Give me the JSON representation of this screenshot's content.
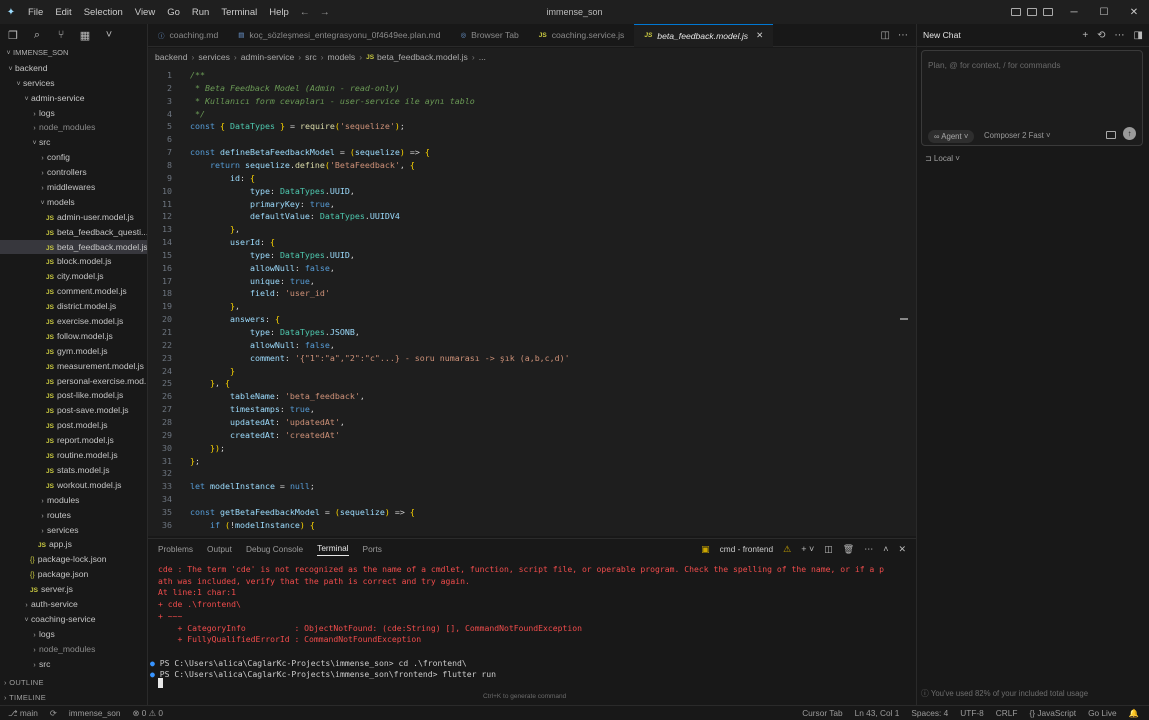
{
  "window": {
    "title": "immense_son",
    "menu": [
      "File",
      "Edit",
      "Selection",
      "View",
      "Go",
      "Run",
      "Terminal",
      "Help"
    ]
  },
  "explorer": {
    "root": "IMMENSE_SON",
    "items": [
      {
        "label": "backend",
        "depth": 0,
        "type": "folder-open"
      },
      {
        "label": "services",
        "depth": 1,
        "type": "folder-open"
      },
      {
        "label": "admin-service",
        "depth": 2,
        "type": "folder-open"
      },
      {
        "label": "logs",
        "depth": 3,
        "type": "folder"
      },
      {
        "label": "node_modules",
        "depth": 3,
        "type": "folder",
        "dim": true
      },
      {
        "label": "src",
        "depth": 3,
        "type": "folder-open"
      },
      {
        "label": "config",
        "depth": 4,
        "type": "folder"
      },
      {
        "label": "controllers",
        "depth": 4,
        "type": "folder"
      },
      {
        "label": "middlewares",
        "depth": 4,
        "type": "folder"
      },
      {
        "label": "models",
        "depth": 4,
        "type": "folder-open"
      },
      {
        "label": "admin-user.model.js",
        "depth": 5,
        "type": "js"
      },
      {
        "label": "beta_feedback_questi...",
        "depth": 5,
        "type": "js"
      },
      {
        "label": "beta_feedback.model.js",
        "depth": 5,
        "type": "js",
        "selected": true
      },
      {
        "label": "block.model.js",
        "depth": 5,
        "type": "js"
      },
      {
        "label": "city.model.js",
        "depth": 5,
        "type": "js"
      },
      {
        "label": "comment.model.js",
        "depth": 5,
        "type": "js"
      },
      {
        "label": "district.model.js",
        "depth": 5,
        "type": "js"
      },
      {
        "label": "exercise.model.js",
        "depth": 5,
        "type": "js"
      },
      {
        "label": "follow.model.js",
        "depth": 5,
        "type": "js"
      },
      {
        "label": "gym.model.js",
        "depth": 5,
        "type": "js"
      },
      {
        "label": "measurement.model.js",
        "depth": 5,
        "type": "js"
      },
      {
        "label": "personal-exercise.mod...",
        "depth": 5,
        "type": "js"
      },
      {
        "label": "post-like.model.js",
        "depth": 5,
        "type": "js"
      },
      {
        "label": "post-save.model.js",
        "depth": 5,
        "type": "js"
      },
      {
        "label": "post.model.js",
        "depth": 5,
        "type": "js"
      },
      {
        "label": "report.model.js",
        "depth": 5,
        "type": "js"
      },
      {
        "label": "routine.model.js",
        "depth": 5,
        "type": "js"
      },
      {
        "label": "stats.model.js",
        "depth": 5,
        "type": "js"
      },
      {
        "label": "workout.model.js",
        "depth": 5,
        "type": "js"
      },
      {
        "label": "modules",
        "depth": 4,
        "type": "folder"
      },
      {
        "label": "routes",
        "depth": 4,
        "type": "folder"
      },
      {
        "label": "services",
        "depth": 4,
        "type": "folder"
      },
      {
        "label": "app.js",
        "depth": 4,
        "type": "js"
      },
      {
        "label": "package-lock.json",
        "depth": 3,
        "type": "json"
      },
      {
        "label": "package.json",
        "depth": 3,
        "type": "json"
      },
      {
        "label": "server.js",
        "depth": 3,
        "type": "js"
      },
      {
        "label": "auth-service",
        "depth": 2,
        "type": "folder"
      },
      {
        "label": "coaching-service",
        "depth": 2,
        "type": "folder-open"
      },
      {
        "label": "logs",
        "depth": 3,
        "type": "folder"
      },
      {
        "label": "node_modules",
        "depth": 3,
        "type": "folder",
        "dim": true
      },
      {
        "label": "src",
        "depth": 3,
        "type": "folder"
      }
    ],
    "outline_label": "OUTLINE",
    "timeline_label": "TIMELINE"
  },
  "tabs": [
    {
      "label": "coaching.md",
      "icon": "info-icon",
      "active": false
    },
    {
      "label": "koç_sözleşmesi_entegrasyonu_0f4649ee.plan.md",
      "icon": "doc-icon",
      "active": false
    },
    {
      "label": "Browser Tab",
      "icon": "globe-icon",
      "active": false
    },
    {
      "label": "coaching.service.js",
      "icon": "js-icon",
      "active": false
    },
    {
      "label": "beta_feedback.model.js",
      "icon": "js-icon",
      "active": true
    }
  ],
  "breadcrumb": [
    "backend",
    "services",
    "admin-service",
    "src",
    "models",
    "beta_feedback.model.js",
    "..."
  ],
  "code_lines": [
    "/**",
    " * Beta Feedback Model (Admin - read-only)",
    " * Kullanıcı form cevapları - user-service ile aynı tablo",
    " */",
    "const { DataTypes } = require('sequelize');",
    "",
    "const defineBetaFeedbackModel = (sequelize) => {",
    "    return sequelize.define('BetaFeedback', {",
    "        id: {",
    "            type: DataTypes.UUID,",
    "            primaryKey: true,",
    "            defaultValue: DataTypes.UUIDV4",
    "        },",
    "        userId: {",
    "            type: DataTypes.UUID,",
    "            allowNull: false,",
    "            unique: true,",
    "            field: 'user_id'",
    "        },",
    "        answers: {",
    "            type: DataTypes.JSONB,",
    "            allowNull: false,",
    "            comment: '{\"1\":\"a\",\"2\":\"c\"...} - soru numarası -> şık (a,b,c,d)'",
    "        }",
    "    }, {",
    "        tableName: 'beta_feedback',",
    "        timestamps: true,",
    "        updatedAt: 'updatedAt',",
    "        createdAt: 'createdAt'",
    "    });",
    "};",
    "",
    "let modelInstance = null;",
    "",
    "const getBetaFeedbackModel = (sequelize) => {",
    "    if (!modelInstance) {"
  ],
  "panel": {
    "tabs": [
      "Problems",
      "Output",
      "Debug Console",
      "Terminal",
      "Ports"
    ],
    "active_tab": "Terminal",
    "terminal_name": "cmd - frontend",
    "terminal_lines": [
      {
        "text": "cde : The term 'cde' is not recognized as the name of a cmdlet, function, script file, or operable program. Check the spelling of the name, or if a p",
        "kind": "err"
      },
      {
        "text": "ath was included, verify that the path is correct and try again.",
        "kind": "err"
      },
      {
        "text": "At line:1 char:1",
        "kind": "err"
      },
      {
        "text": "+ cde .\\frontend\\",
        "kind": "err"
      },
      {
        "text": "+ ~~~",
        "kind": "err"
      },
      {
        "text": "    + CategoryInfo          : ObjectNotFound: (cde:String) [], CommandNotFoundException",
        "kind": "err"
      },
      {
        "text": "    + FullyQualifiedErrorId : CommandNotFoundException",
        "kind": "err"
      },
      {
        "text": "",
        "kind": "ok"
      },
      {
        "text": "PS C:\\Users\\alica\\CaglarKc-Projects\\immense_son> cd .\\frontend\\",
        "kind": "prompt"
      },
      {
        "text": "PS C:\\Users\\alica\\CaglarKc-Projects\\immense_son\\frontend> flutter run",
        "kind": "prompt"
      }
    ],
    "hint": "Ctrl+K to generate command"
  },
  "chat": {
    "title": "New Chat",
    "placeholder": "Plan, @ for context, / for commands",
    "agent_label": "∞ Agent ˅",
    "model_label": "Composer 2 Fast ˅",
    "local_label": "⊐ Local ˅",
    "usage": "You've used 82% of your included total usage"
  },
  "status": {
    "left": [
      "⎇ main",
      "⟳",
      "immense_son",
      "⊗ 0 ⚠ 0"
    ],
    "right": [
      "Cursor Tab",
      "Ln 43, Col 1",
      "Spaces: 4",
      "UTF-8",
      "CRLF",
      "{} JavaScript",
      "Go Live",
      "🔔"
    ]
  }
}
